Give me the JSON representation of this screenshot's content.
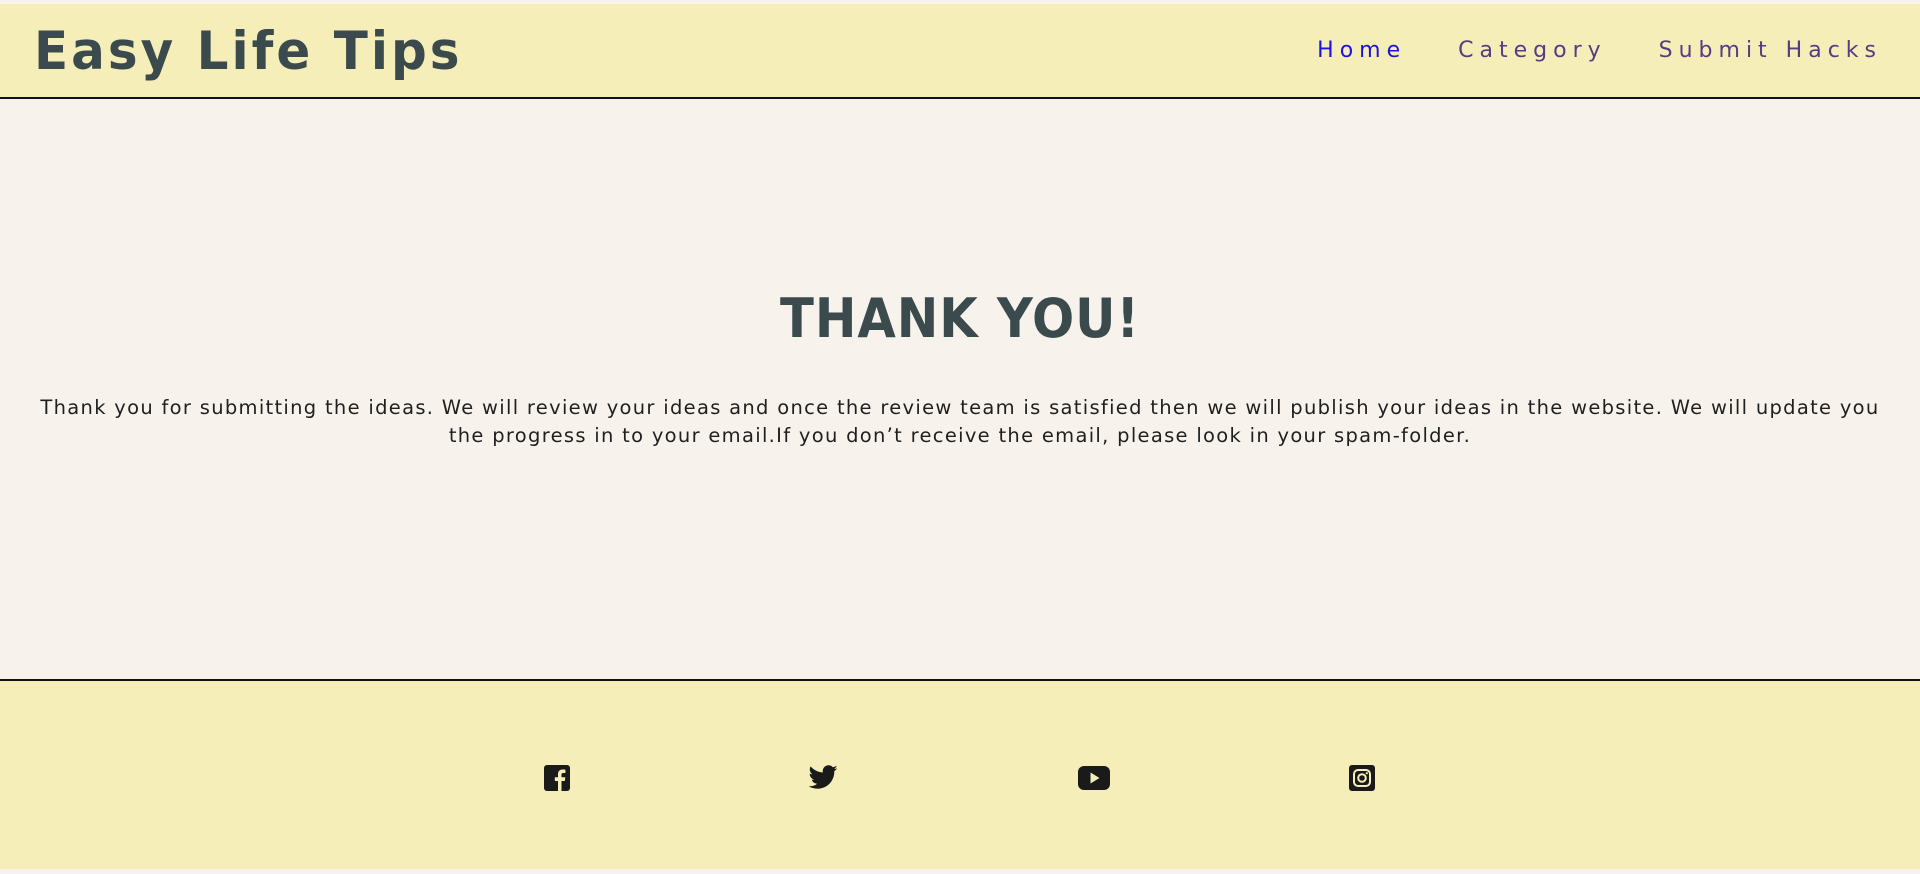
{
  "header": {
    "logo": "Easy Life Tips",
    "nav": [
      {
        "label": "Home"
      },
      {
        "label": "Category"
      },
      {
        "label": "Submit Hacks"
      }
    ]
  },
  "main": {
    "title": "THANK YOU!",
    "message": "Thank you for submitting the ideas. We will review your ideas and once the review team is satisfied then we will publish your ideas in the website. We will update you the progress in to your email.If you don’t receive the email, please look in your spam-folder."
  },
  "footer": {
    "social": [
      {
        "icon": "facebook-icon"
      },
      {
        "icon": "twitter-icon"
      },
      {
        "icon": "youtube-icon"
      },
      {
        "icon": "instagram-icon"
      }
    ]
  },
  "colors": {
    "header_bg": "#f5eeb9",
    "page_bg": "#f7f3ec",
    "heading": "#3b4a4c",
    "link": "#1d12e6",
    "link_visited": "#5a3a82"
  }
}
